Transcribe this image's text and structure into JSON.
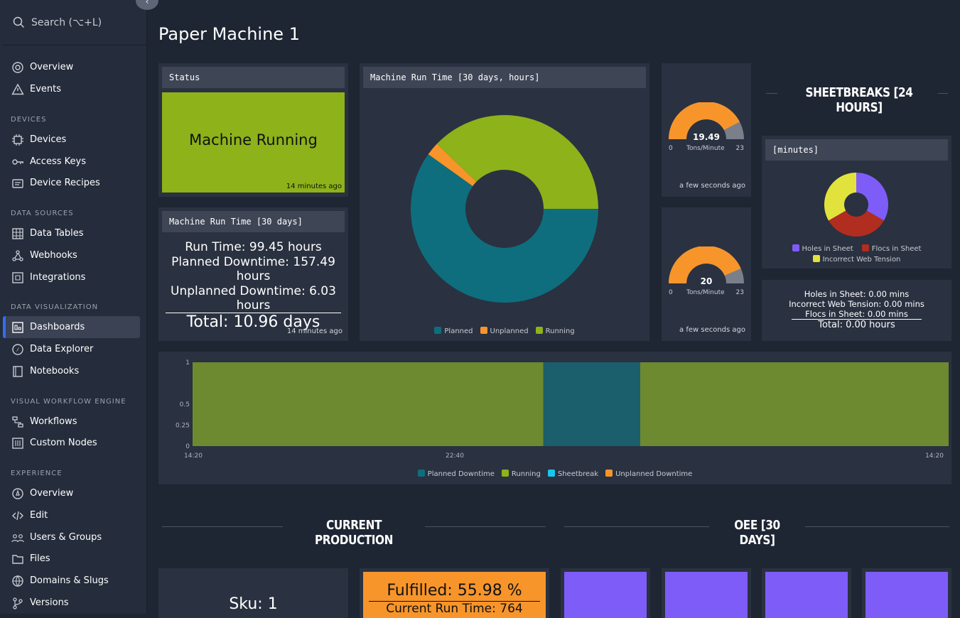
{
  "sidebar": {
    "search_placeholder": "Search (⌥+L)",
    "top_items": [
      {
        "label": "Overview",
        "icon": "overview-icon"
      },
      {
        "label": "Events",
        "icon": "warning-icon"
      }
    ],
    "sections": [
      {
        "title": "DEVICES",
        "items": [
          {
            "label": "Devices"
          },
          {
            "label": "Access Keys"
          },
          {
            "label": "Device Recipes"
          }
        ]
      },
      {
        "title": "DATA SOURCES",
        "items": [
          {
            "label": "Data Tables"
          },
          {
            "label": "Webhooks"
          },
          {
            "label": "Integrations"
          }
        ]
      },
      {
        "title": "DATA VISUALIZATION",
        "items": [
          {
            "label": "Dashboards"
          },
          {
            "label": "Data Explorer"
          },
          {
            "label": "Notebooks"
          }
        ]
      },
      {
        "title": "VISUAL WORKFLOW ENGINE",
        "items": [
          {
            "label": "Workflows"
          },
          {
            "label": "Custom Nodes"
          }
        ]
      },
      {
        "title": "EXPERIENCE",
        "items": [
          {
            "label": "Overview"
          },
          {
            "label": "Edit"
          },
          {
            "label": "Users & Groups"
          },
          {
            "label": "Files"
          },
          {
            "label": "Domains & Slugs"
          },
          {
            "label": "Versions"
          }
        ]
      }
    ],
    "active_item": "Dashboards"
  },
  "page": {
    "title": "Paper Machine 1"
  },
  "status_card": {
    "header": "Status",
    "value": "Machine Running",
    "ago": "14 minutes ago",
    "color": "#8db21a"
  },
  "runtime_card": {
    "header": "Machine Run Time [30 days]",
    "line1": "Run Time: 99.45 hours",
    "line2a": "Planned Downtime: 157.49",
    "line2b": "hours",
    "line3a": "Unplanned Downtime: 6.03",
    "line3b": "hours",
    "total": "Total: 10.96 days",
    "ago": "14 minutes ago"
  },
  "gauges": [
    {
      "value": "19.49",
      "min": "0",
      "max": "23",
      "unit": "Tons/Minute",
      "fraction": 0.847,
      "ago": "a few seconds ago"
    },
    {
      "value": "20",
      "min": "0",
      "max": "23",
      "unit": "Tons/Minute",
      "fraction": 0.87,
      "ago": "a few seconds ago"
    }
  ],
  "sheetbreaks": {
    "heading": "SHEETBREAKS [24 HOURS]",
    "card_header": "[minutes]",
    "summary": [
      "Holes in Sheet: 0.00 mins",
      "Incorrect Web Tension: 0.00 mins",
      "Flocs in Sheet: 0.00 mins"
    ],
    "total": "Total: 0.00 hours"
  },
  "sections": {
    "current_production": "CURRENT PRODUCTION",
    "oee": "OEE [30 DAYS]"
  },
  "production": {
    "sku": "Sku: 1",
    "fulfilled": "Fulfilled: 55.98 %",
    "current_run": "Current Run Time: 764"
  },
  "colors": {
    "planned": "#0e6e7e",
    "unplanned": "#f7952b",
    "running": "#8db21a",
    "sheetbreak": "#16c7ef",
    "purple": "#7e5cf8",
    "red": "#b12d1f",
    "yellow": "#e1e33c"
  },
  "chart_data": [
    {
      "type": "pie",
      "title": "Machine Run Time [30 days, hours]",
      "labels": [
        "Planned",
        "Unplanned",
        "Running"
      ],
      "values": [
        157.49,
        6.03,
        99.45
      ],
      "colors": [
        "#0e6e7e",
        "#f7952b",
        "#8db21a"
      ],
      "legend": "bottom"
    },
    {
      "type": "pie",
      "title": "[minutes]",
      "labels": [
        "Holes in Sheet",
        "Flocs in Sheet",
        "Incorrect Web Tension"
      ],
      "values": [
        1,
        1,
        1
      ],
      "colors": [
        "#7e5cf8",
        "#b12d1f",
        "#e1e33c"
      ],
      "legend": "bottom"
    },
    {
      "type": "area",
      "title": "",
      "x_ticks": [
        "14:20",
        "22:40",
        "14:20"
      ],
      "y_ticks": [
        "0",
        "0.25",
        "0.5",
        "1"
      ],
      "ylim": [
        0,
        1
      ],
      "series": [
        {
          "name": "Planned Downtime",
          "color": "#0e6e7e"
        },
        {
          "name": "Running",
          "color": "#8db21a"
        },
        {
          "name": "Sheetbreak",
          "color": "#16c7ef"
        },
        {
          "name": "Unplanned Downtime",
          "color": "#f7952b"
        }
      ],
      "segments": [
        {
          "state": "Running",
          "start_fraction": 0,
          "end_fraction": 0.464
        },
        {
          "state": "Planned Downtime",
          "start_fraction": 0.464,
          "end_fraction": 0.592
        },
        {
          "state": "Running",
          "start_fraction": 0.592,
          "end_fraction": 1
        }
      ],
      "legend": "bottom"
    }
  ]
}
